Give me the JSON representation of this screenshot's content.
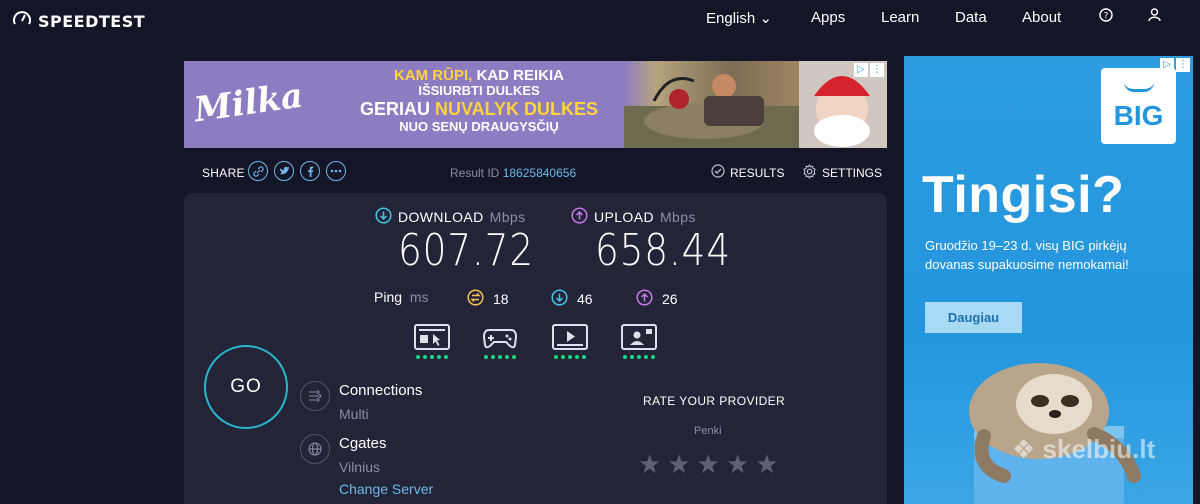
{
  "header": {
    "logo": "SPEEDTEST",
    "nav": [
      "English",
      "Apps",
      "Learn",
      "Data",
      "About"
    ]
  },
  "ad_top": {
    "brand": "Milka",
    "line1_a": "KAM RŪPI,",
    "line1_b": " KAD REIKIA",
    "line2": "IŠSIURBTI DULKES",
    "line3_a": "GERIAU ",
    "line3_b": "NUVALYK DULKES",
    "line4": "NUO SENŲ DRAUGYSČIŲ"
  },
  "share": {
    "label": "SHARE",
    "result_label": "Result ID",
    "result_id": "18625840656",
    "results": "RESULTS",
    "settings": "SETTINGS"
  },
  "test": {
    "download_label": "DOWNLOAD",
    "upload_label": "UPLOAD",
    "unit": "Mbps",
    "download": "607.72",
    "upload": "658.44",
    "ping_label": "Ping",
    "ping_unit": "ms",
    "ping_idle": "18",
    "ping_down": "46",
    "ping_up": "26",
    "go": "GO"
  },
  "quality": {
    "icons": [
      "web-browsing-icon",
      "gaming-icon",
      "video-streaming-icon",
      "video-chat-icon"
    ],
    "levels": [
      5,
      5,
      5,
      5
    ],
    "max": 5
  },
  "connection": {
    "connections_label": "Connections",
    "connections_value": "Multi",
    "host": "Cgates",
    "location": "Vilnius",
    "change_server": "Change Server"
  },
  "rating": {
    "title": "RATE YOUR PROVIDER",
    "provider": "Penki",
    "stars": 5
  },
  "ad_side": {
    "logo": "BIG",
    "headline": "Tingisi?",
    "copy": "Gruodžio 19–23 d. visų BIG pirkėjų dovanas supakuosime nemokamai!",
    "cta": "Daugiau",
    "watermark": "skelbiu.lt"
  },
  "colors": {
    "background": "#141526",
    "panel": "#232437",
    "accent": "#6ab9ea",
    "go_ring": "#27b6cc",
    "quality_dot": "#1fd67f",
    "ping_idle": "#f3c55b",
    "ping_down": "#46c5e8",
    "ping_up": "#c57ae8"
  }
}
